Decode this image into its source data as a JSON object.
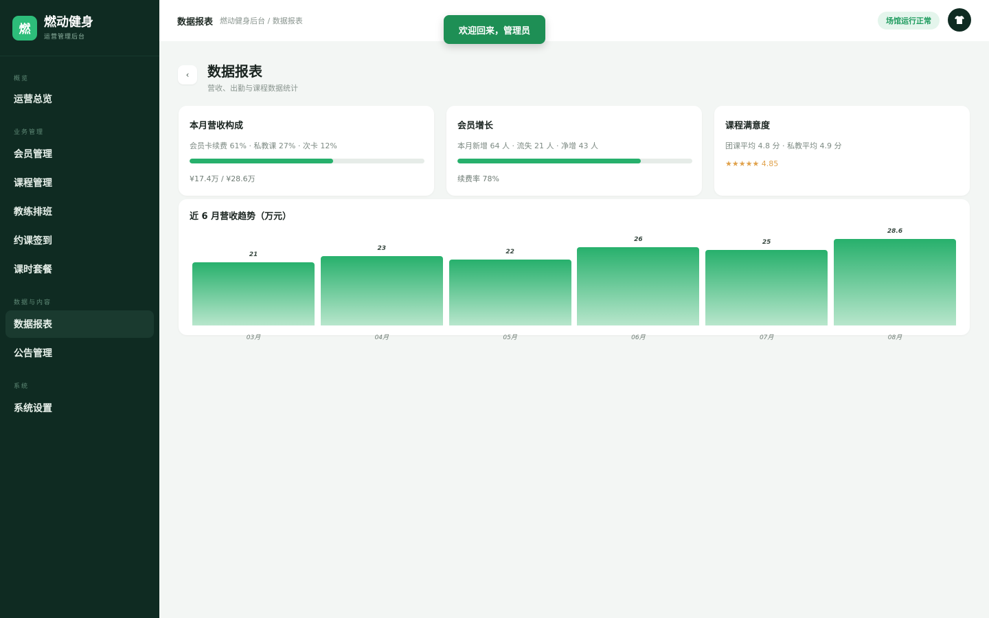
{
  "brand": {
    "logo_char": "燃",
    "name": "燃动健身",
    "subtitle": "运营管理后台"
  },
  "sidebar": {
    "groups": [
      {
        "title": "概览",
        "items": [
          {
            "label": "运营总览"
          }
        ]
      },
      {
        "title": "业务管理",
        "items": [
          {
            "label": "会员管理"
          },
          {
            "label": "课程管理"
          },
          {
            "label": "教练排班"
          },
          {
            "label": "约课签到"
          },
          {
            "label": "课时套餐"
          }
        ]
      },
      {
        "title": "数据与内容",
        "items": [
          {
            "label": "数据报表",
            "active": true
          },
          {
            "label": "公告管理"
          }
        ]
      },
      {
        "title": "系统",
        "items": [
          {
            "label": "系统设置"
          }
        ]
      }
    ]
  },
  "topbar": {
    "title": "数据报表",
    "breadcrumb": "燃动健身后台 / 数据报表",
    "status": "场馆运行正常",
    "avatar_icon": "shirt-icon"
  },
  "toast": {
    "text": "欢迎回来，管理员"
  },
  "page": {
    "back_label": "‹",
    "title": "数据报表",
    "subtitle": "营收、出勤与课程数据统计"
  },
  "cards": {
    "revenue": {
      "title": "本月营收构成",
      "desc": "会员卡续费 61% · 私教课 27% · 次卡 12%",
      "progress": 0.61,
      "foot": "¥17.4万 / ¥28.6万"
    },
    "members": {
      "title": "会员增长",
      "desc": "本月新增 64 人 · 流失 21 人 · 净增 43 人",
      "progress": 0.78,
      "foot": "续费率 78%"
    },
    "satisfaction": {
      "title": "课程满意度",
      "desc": "团课平均 4.8 分 · 私教平均 4.9 分",
      "rating_text": "★★★★★ 4.85"
    }
  },
  "chart_data": {
    "type": "bar",
    "title": "近 6 月营收趋势（万元）",
    "categories": [
      "03月",
      "04月",
      "05月",
      "06月",
      "07月",
      "08月"
    ],
    "values": [
      21,
      23,
      22,
      26,
      25,
      28.6
    ],
    "ylim": [
      0,
      30
    ],
    "color": "#27b06c"
  }
}
